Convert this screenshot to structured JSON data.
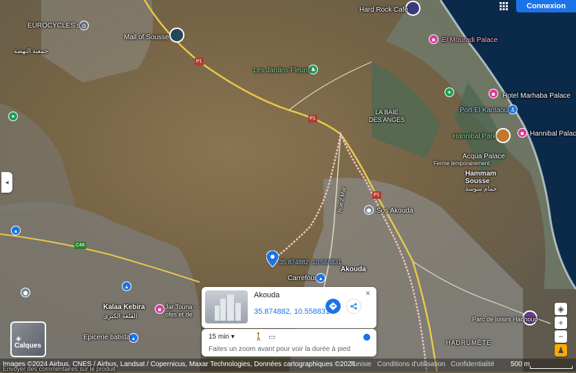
{
  "header": {
    "connexion_label": "Connexion",
    "apps_icon": "grid-apps-icon"
  },
  "roads": {
    "p1_a": "P1",
    "p1_b": "P1",
    "p1_c": "P1",
    "c48": "C48",
    "rue": "Rue 2 Mar"
  },
  "places": {
    "hard_rock": "Hard Rock Cafe",
    "eurocycles": "EUROCYCLES s.a",
    "mall": "Mall of Sousse",
    "jardins": "Les Jardins Fleuris",
    "el_mouradi": "El Mouradi Palace",
    "marhaba": "Hotel Marhaba Palace",
    "port": "Port El Kantaoui",
    "baie": "LA BAIE\nDES ANGES",
    "hannibal_park": "Hannibal Park",
    "hannibal_palace": "Hannibal Palace",
    "acqua": "Acqua Palace",
    "ferme": "Ferme temporairement",
    "hammam": "Hammam\nSousse",
    "hammam_ar": "حمام سوسة",
    "sos": "Sos Akouda",
    "akouda": "Akouda",
    "carrefour": "Carrefour",
    "kalaa": "Kalaa Kebira",
    "kalaa_ar": "القلعة الكبرى",
    "epicerie": "Epicerie batista",
    "jar_touna": "Jar Touna -\nofes et de",
    "parc": "Parc de loisirs Hadhoud",
    "hadrumete": "HADRUMÈTE",
    "ar_top": "جمعية النهضة"
  },
  "pin": {
    "label": "35.874882, 10.558831"
  },
  "card": {
    "title": "Akouda",
    "coords": "35.874882, 10.558831",
    "close": "×"
  },
  "trip": {
    "time": "15 min",
    "note": "Faites un zoom avant pour voir la durée à pied"
  },
  "layers": {
    "label": "Calques"
  },
  "controls": {
    "zoom_in": "+",
    "zoom_out": "−"
  },
  "footer": {
    "attribution": "Images ©2024 Airbus, CNES / Airbus, Landsat / Copernicus, Maxar Technologies, Données cartographiques ©2024",
    "country": "Tunisie",
    "terms": "Conditions d'utilisation",
    "privacy": "Confidentialité",
    "scale": "500 m",
    "feedback": "Envoyer des commentaires sur le produit"
  },
  "colors": {
    "accent": "#1a73e8",
    "pin": "#1a73e8",
    "route": "#f2c4c4",
    "sea": "#0b2a4a"
  }
}
